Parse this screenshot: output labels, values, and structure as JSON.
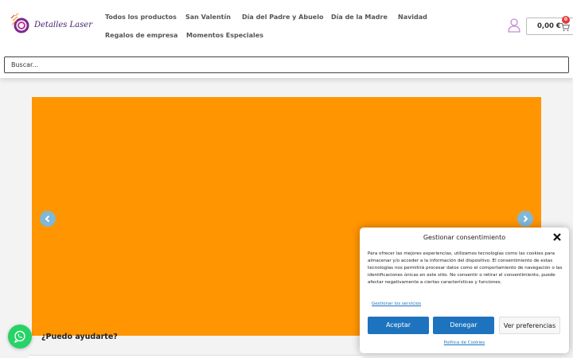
{
  "brand": {
    "name": "Detalles Laser"
  },
  "nav": {
    "items": [
      {
        "label": "Todos los productos"
      },
      {
        "label": "San Valentín"
      },
      {
        "label": "Día del Padre y Abuelo"
      },
      {
        "label": "Día de la Madre"
      },
      {
        "label": "Navidad"
      },
      {
        "label": "Regalos de empresa"
      },
      {
        "label": "Momentos Especiales"
      }
    ]
  },
  "cart": {
    "total": "0,00 €",
    "count": "0"
  },
  "search": {
    "placeholder": "Buscar..."
  },
  "slider": {
    "color": "#ff9500"
  },
  "help": {
    "text": "¿Puedo ayudarte?"
  },
  "consent": {
    "title": "Gestionar consentimiento",
    "body": "Para ofrecer las mejores experiencias, utilizamos tecnologías como las cookies para almacenar y/o acceder a la información del dispositivo. El consentimiento de estas tecnologías nos permitirá procesar datos como el comportamiento de navegación o las identificaciones únicas en este sitio. No consentir o retirar el consentimiento, puede afectar negativamente a ciertas características y funciones.",
    "manage_link": "Gestionar los servicios",
    "accept_label": "Aceptar",
    "deny_label": "Denegar",
    "prefs_label": "Ver preferencias",
    "policy_link": "Política de Cookies"
  },
  "colors": {
    "accent": "#1e73be",
    "orange": "#ff9500",
    "whatsapp": "#25d366",
    "badge": "#e23a3a"
  },
  "icons": [
    "user-icon",
    "cart-icon",
    "chevron-left-icon",
    "chevron-right-icon",
    "whatsapp-icon",
    "close-icon"
  ]
}
